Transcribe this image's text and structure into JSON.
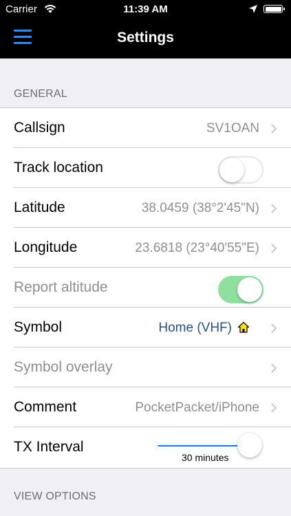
{
  "status_bar": {
    "carrier": "Carrier",
    "time": "11:39 AM",
    "icons": [
      "wifi-icon",
      "location-arrow-icon",
      "battery-icon"
    ]
  },
  "nav": {
    "title": "Settings",
    "menu_icon": "hamburger-menu-icon",
    "accent": "#2f8cff"
  },
  "sections": {
    "general": "GENERAL",
    "view_options": "VIEW OPTIONS"
  },
  "rows": {
    "callsign": {
      "label": "Callsign",
      "value": "SV1OAN"
    },
    "track_location": {
      "label": "Track location",
      "toggle": false
    },
    "latitude": {
      "label": "Latitude",
      "value": "38.0459 (38°2'45\"N)"
    },
    "longitude": {
      "label": "Longitude",
      "value": "23.6818 (23°40'55\"E)"
    },
    "report_altitude": {
      "label": "Report altitude",
      "toggle": true,
      "enabled": false
    },
    "symbol": {
      "label": "Symbol",
      "value": "Home (VHF)",
      "icon": "home-icon"
    },
    "symbol_overlay": {
      "label": "Symbol overlay",
      "enabled": false
    },
    "comment": {
      "label": "Comment",
      "value": "PocketPacket/iPhone"
    },
    "tx_interval": {
      "label": "TX Interval",
      "value_caption": "30 minutes",
      "slider_fraction": 1.0
    }
  },
  "colors": {
    "toggle_on": "#8fe09f",
    "symbol_value": "#2b4f8a",
    "slider": "#0a76ff"
  }
}
